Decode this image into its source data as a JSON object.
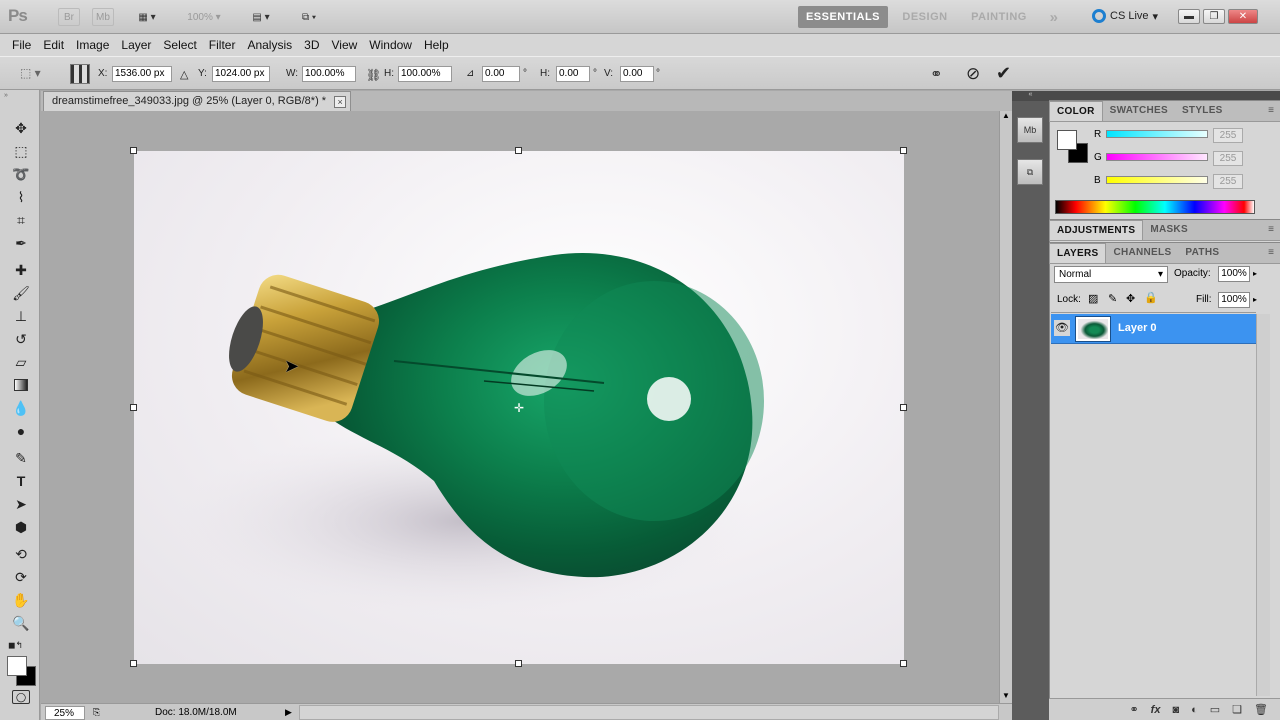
{
  "app": {
    "logo": "Ps",
    "bridge_label": "Br",
    "minibridge_label": "Mb",
    "zoom_display": "100%",
    "workspaces": [
      "ESSENTIALS",
      "DESIGN",
      "PAINTING"
    ],
    "active_workspace": "ESSENTIALS",
    "more_workspaces": "»",
    "cs_live": "CS Live"
  },
  "menu": [
    "File",
    "Edit",
    "Image",
    "Layer",
    "Select",
    "Filter",
    "Analysis",
    "3D",
    "View",
    "Window",
    "Help"
  ],
  "options": {
    "x_label": "X:",
    "x_value": "1536.00 px",
    "y_label": "Y:",
    "y_value": "1024.00 px",
    "w_label": "W:",
    "w_value": "100.00%",
    "h_label": "H:",
    "h_value": "100.00%",
    "angle_value": "0.00",
    "deg": "°",
    "hskew_label": "H:",
    "hskew_value": "0.00",
    "vskew_label": "V:",
    "vskew_value": "0.00"
  },
  "document": {
    "tab_title": "dreamstimefree_349033.jpg @ 25% (Layer 0, RGB/8*) *",
    "close": "×",
    "zoom": "25%",
    "doc_size": "Doc: 18.0M/18.0M"
  },
  "panels": {
    "color_tabs": [
      "COLOR",
      "SWATCHES",
      "STYLES"
    ],
    "channels": [
      {
        "name": "R",
        "value": "255",
        "color": "#00e5ff"
      },
      {
        "name": "G",
        "value": "255",
        "color": "#ff00ff"
      },
      {
        "name": "B",
        "value": "255",
        "color": "#ffff00"
      }
    ],
    "adjust_tabs": [
      "ADJUSTMENTS",
      "MASKS"
    ],
    "layer_tabs": [
      "LAYERS",
      "CHANNELS",
      "PATHS"
    ],
    "blend_mode": "Normal",
    "opacity_label": "Opacity:",
    "opacity_value": "100%",
    "lock_label": "Lock:",
    "fill_label": "Fill:",
    "fill_value": "100%",
    "layers": [
      {
        "name": "Layer 0",
        "visible": true,
        "selected": true
      }
    ]
  },
  "colors": {
    "selection_blue": "#3c93f0",
    "bulb_green": "#0e7a4a",
    "brass": "#c9a23a"
  }
}
